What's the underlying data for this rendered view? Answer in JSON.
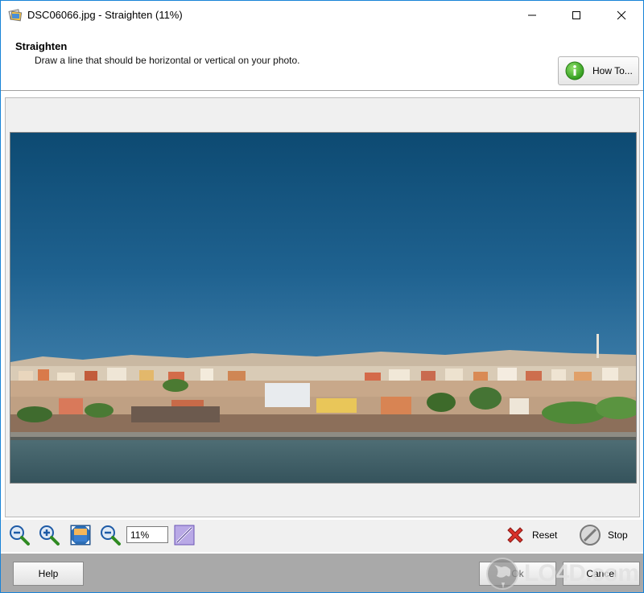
{
  "window": {
    "title": "DSC06066.jpg - Straighten (11%)"
  },
  "header": {
    "title": "Straighten",
    "subtitle": "Draw a line that should be horizontal or vertical on your photo.",
    "howto_label": "How To..."
  },
  "toolbar": {
    "zoom_value": "11%",
    "reset_label": "Reset",
    "stop_label": "Stop"
  },
  "footer": {
    "help_label": "Help",
    "ok_label": "Ok",
    "cancel_label": "Cancel"
  },
  "watermark": {
    "text": "LO4D.com"
  },
  "colors": {
    "sky_top": "#0d4f7a",
    "sky_bottom": "#2e6e9c",
    "water": "#3d5d66",
    "accent": "#1883d7"
  }
}
